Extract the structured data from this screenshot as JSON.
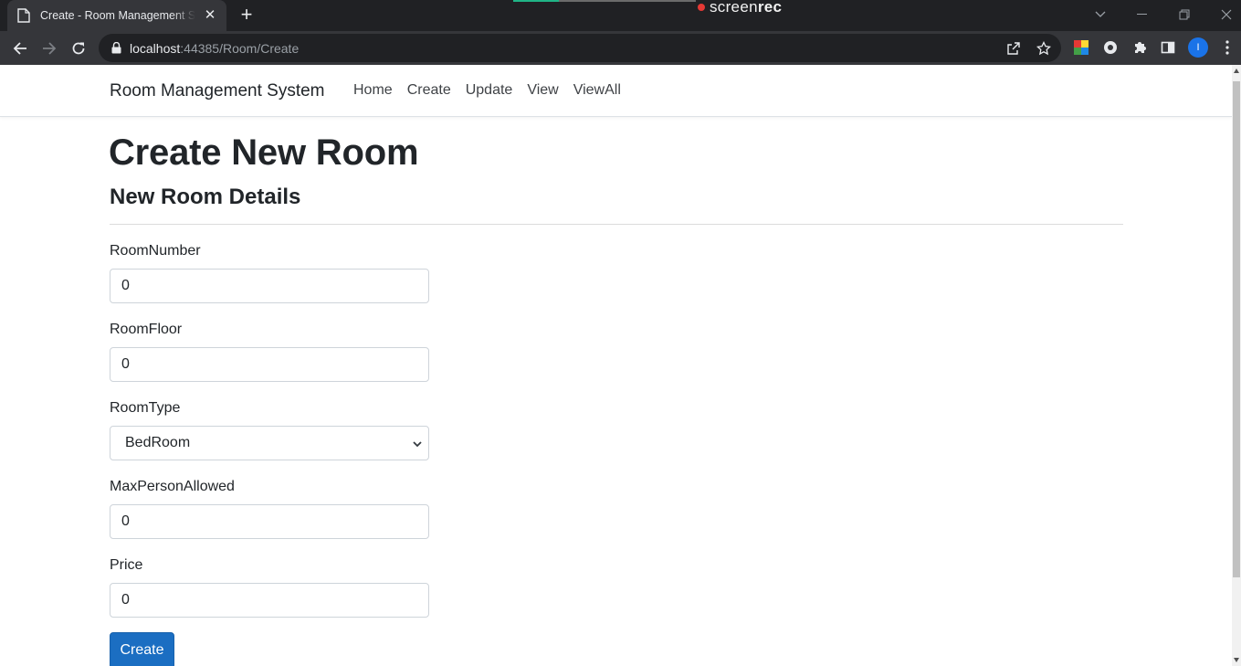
{
  "browser": {
    "tab_title": "Create - Room Management System",
    "url_host": "localhost",
    "url_rest": ":44385/Room/Create",
    "recorder_prefix": "screen",
    "recorder_suffix": "rec",
    "profile_initial": "I"
  },
  "navbar": {
    "brand": "Room Management System",
    "links": [
      "Home",
      "Create",
      "Update",
      "View",
      "ViewAll"
    ]
  },
  "page": {
    "title": "Create New Room",
    "subtitle": "New Room Details"
  },
  "form": {
    "fields": [
      {
        "label": "RoomNumber",
        "value": "0"
      },
      {
        "label": "RoomFloor",
        "value": "0"
      },
      {
        "label": "RoomType",
        "value": "BedRoom"
      },
      {
        "label": "MaxPersonAllowed",
        "value": "0"
      },
      {
        "label": "Price",
        "value": "0"
      }
    ],
    "submit_label": "Create"
  },
  "colors": {
    "primary_button": "#1b6ec2",
    "chrome_dark": "#202124",
    "chrome_toolbar": "#35363a"
  }
}
